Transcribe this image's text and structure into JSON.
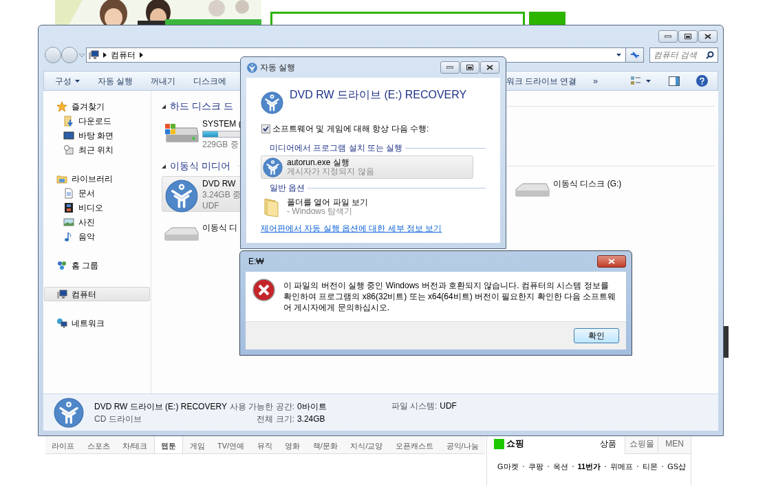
{
  "web_page": {
    "categories": [
      {
        "label": "라이프",
        "selected": false
      },
      {
        "label": "스포츠",
        "selected": false
      },
      {
        "label": "차/테크",
        "selected": false
      },
      {
        "label": "웹툰",
        "selected": true
      },
      {
        "label": "게임",
        "selected": false
      },
      {
        "label": "TV/연예",
        "selected": false
      },
      {
        "label": "뮤직",
        "selected": false
      },
      {
        "label": "영화",
        "selected": false
      },
      {
        "label": "책/문화",
        "selected": false
      },
      {
        "label": "지식/교양",
        "selected": false
      },
      {
        "label": "오픈캐스트",
        "selected": false
      },
      {
        "label": "공익/나눔",
        "selected": false
      }
    ],
    "shopping": {
      "title": "쇼핑",
      "tabs": [
        {
          "label": "상품",
          "selected": true
        },
        {
          "label": "쇼핑몰",
          "selected": false
        },
        {
          "label": "MEN",
          "selected": false
        }
      ],
      "malls": [
        {
          "label": "G마켓",
          "bold": false
        },
        {
          "label": "쿠팡",
          "bold": false
        },
        {
          "label": "옥션",
          "bold": false
        },
        {
          "label": "11번가",
          "bold": true
        },
        {
          "label": "위메프",
          "bold": false
        },
        {
          "label": "티몬",
          "bold": false
        },
        {
          "label": "GS샵",
          "bold": false
        }
      ]
    }
  },
  "explorer": {
    "breadcrumb": [
      "컴퓨터"
    ],
    "search": {
      "placeholder": "컴퓨터 검색"
    },
    "toolbar": [
      {
        "label": "구성",
        "dropdown": true
      },
      {
        "label": "자동 실행",
        "dropdown": false
      },
      {
        "label": "꺼내기",
        "dropdown": false
      },
      {
        "label": "디스크에",
        "dropdown": false
      }
    ],
    "toolbar_tail": "워크 드라이브 연결",
    "overflow": "»",
    "nav": [
      {
        "label": "즐겨찾기",
        "kind": "star",
        "selected": false,
        "children": [
          {
            "label": "다운로드",
            "kind": "download",
            "selected": false
          },
          {
            "label": "바탕 화면",
            "kind": "desktop",
            "selected": false
          },
          {
            "label": "최근 위치",
            "kind": "recent",
            "selected": false
          }
        ]
      },
      {
        "label": "라이브러리",
        "kind": "library",
        "selected": false,
        "children": [
          {
            "label": "문서",
            "kind": "document",
            "selected": false
          },
          {
            "label": "비디오",
            "kind": "video",
            "selected": false
          },
          {
            "label": "사진",
            "selected": false
          },
          {
            "label": "음악",
            "kind": "music",
            "selected": false
          }
        ]
      },
      {
        "label": "홈 그룹",
        "kind": "homegroup",
        "selected": false
      },
      {
        "label": "컴퓨터",
        "kind": "computer",
        "selected": true
      },
      {
        "label": "네트워크",
        "kind": "network",
        "selected": false
      }
    ],
    "groups": [
      {
        "title": "하드 디스크 드",
        "items": [
          {
            "kind": "hdd",
            "name": "SYSTEM (",
            "size": "229GB 중",
            "level": 0.15,
            "selected": false
          }
        ]
      },
      {
        "title": "이동식 미디어",
        "items": [
          {
            "kind": "dvd",
            "name": "DVD RW",
            "size": "3.24GB 중",
            "fs": "UDF",
            "selected": true
          },
          {
            "kind": "removable",
            "name": "이동식 디스크 (G:)",
            "selected": false
          },
          {
            "kind": "removable",
            "name": "이동식 디",
            "selected": false
          }
        ]
      }
    ],
    "details": {
      "name": "DVD RW 드라이브 (E:) RECOVERY",
      "type": "CD 드라이브",
      "fields": [
        {
          "label": "사용 가능한 공간:",
          "value": "0바이트"
        },
        {
          "label": "전체 크기:",
          "value": "3.24GB"
        },
        {
          "label": "파일 시스템:",
          "value": "UDF"
        }
      ]
    }
  },
  "autoplay": {
    "title": "자동 실행",
    "heading": "DVD RW 드라이브 (E:) RECOVERY",
    "always": {
      "label": "소프트웨어 및 게임에 대해 항상 다음 수행:",
      "checked": true
    },
    "sections": [
      {
        "title": "미디어에서 프로그램 설치 또는 실행",
        "options": [
          {
            "kind": "emblem",
            "title": "autorun.exe 실행",
            "subtitle": "게시자가 지정되지 않음",
            "selected": true
          }
        ]
      },
      {
        "title": "일반 옵션",
        "options": [
          {
            "kind": "folder",
            "title": "폴더를 열어 파일 보기",
            "subtitle": "- Windows 탐색기",
            "selected": false
          }
        ]
      }
    ],
    "link": "제어판에서 자동 실행 옵션에 대한 세부 정보 보기"
  },
  "error_dialog": {
    "title": "E:₩",
    "message": "이 파일의 버전이 실행 중인 Windows 버전과 호환되지 않습니다. 컴퓨터의 시스템 정보를 확인하여 프로그램의 x86(32비트) 또는 x64(64비트) 버전이 필요한지 확인한 다음 소프트웨어 게시자에게 문의하십시오.",
    "button": "확인"
  }
}
